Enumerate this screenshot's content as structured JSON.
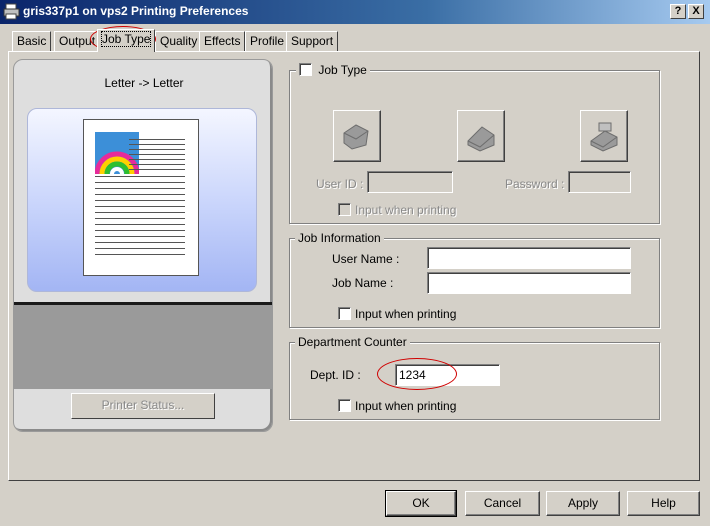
{
  "window": {
    "title": "gris337p1 on vps2 Printing Preferences",
    "help_btn": "?",
    "close_btn": "X"
  },
  "tabs": [
    {
      "label": "Basic"
    },
    {
      "label": "Output"
    },
    {
      "label": "Job Type"
    },
    {
      "label": "Quality"
    },
    {
      "label": "Effects"
    },
    {
      "label": "Profile"
    },
    {
      "label": "Support"
    }
  ],
  "preview": {
    "paper_label": "Letter -> Letter",
    "printer_status": "Printer Status..."
  },
  "job_type": {
    "checkbox_label": "Job Type",
    "checked": false,
    "user_id_label": "User ID :",
    "user_id_value": "",
    "password_label": "Password :",
    "password_value": "",
    "input_when_printing": "Input when printing"
  },
  "job_information": {
    "legend": "Job Information",
    "user_name_label": "User Name :",
    "user_name_value": "",
    "job_name_label": "Job Name :",
    "job_name_value": "",
    "input_when_printing": "Input when printing"
  },
  "department_counter": {
    "legend": "Department Counter",
    "dept_id_label": "Dept. ID :",
    "dept_id_value": "1234",
    "input_when_printing": "Input when printing"
  },
  "buttons": {
    "ok": "OK",
    "cancel": "Cancel",
    "apply": "Apply",
    "help": "Help"
  },
  "colors": {
    "title_bar": "#0a246a",
    "dialog_bg": "#d4d0c8",
    "annotation": "#d00000"
  }
}
